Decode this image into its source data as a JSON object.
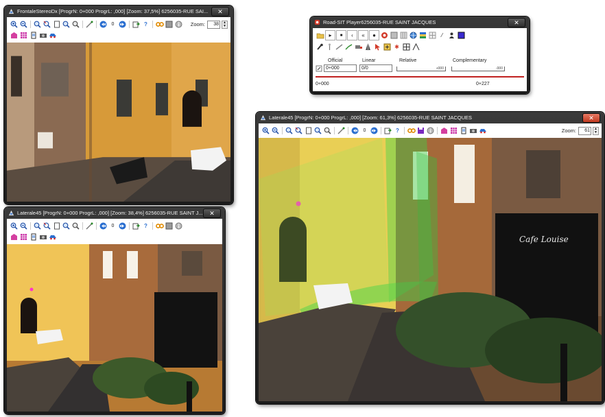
{
  "windows": {
    "frontale": {
      "title": "FrontaleStereoDx  [ProgrN: 0+000 ProgrL: ,000] [Zoom: 37,5%] 6256035-RUE SAI...",
      "close": "✕",
      "zoom_label": "Zoom:",
      "zoom_value": "38"
    },
    "laterale_small": {
      "title": "Laterale45  [ProgrN: 0+000 ProgrL: ,000] [Zoom: 38,4%] 6256035-RUE SAINT J...",
      "close": "✕"
    },
    "laterale_large": {
      "title": "Laterale45  [ProgrN: 0+000 ProgrL: ,000] [Zoom: 61,3%] 6256035-RUE SAINT JACQUES",
      "close": "✕",
      "zoom_label": "Zoom:",
      "zoom_value": "61"
    },
    "player": {
      "title": "Road-SIT Player6256035-RUE SAINT JACQUES",
      "close": "✕",
      "official_label": "Official",
      "official_value": "0+000",
      "linear_label": "Linear",
      "linear_value": "0/0",
      "relative_label": "Relative",
      "relative_scale": "+000",
      "complementary_label": "Complementary",
      "complementary_scale": "-000",
      "start_value": "0+000",
      "end_value": "0+227"
    }
  },
  "scene_text": {
    "cafe_sign": "Cafe Louise"
  },
  "icons": {
    "zoom_in": "zoom-in-icon",
    "zoom_out": "zoom-out-icon",
    "camera": "camera-icon",
    "map": "map-icon"
  },
  "colors": {
    "close_active": "#c0391f",
    "progress_bar": "#c0211f",
    "point_cloud": "#39d64a"
  }
}
